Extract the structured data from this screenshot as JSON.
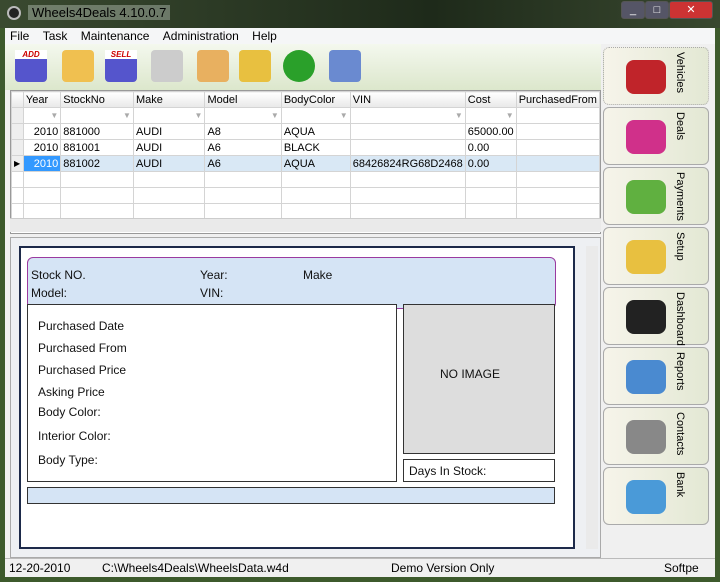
{
  "title": "Wheels4Deals 4.10.0.7",
  "menu": [
    "File",
    "Task",
    "Maintenance",
    "Administration",
    "Help"
  ],
  "toolbar": [
    {
      "name": "add-vehicle",
      "label": "ADD",
      "color": "#5555cc"
    },
    {
      "name": "open-folder",
      "label": "",
      "color": "#f0c050"
    },
    {
      "name": "sell-vehicle",
      "label": "SELL",
      "color": "#5555cc"
    },
    {
      "name": "print",
      "label": "",
      "color": "#cccccc"
    },
    {
      "name": "report",
      "label": "",
      "color": "#e8b060"
    },
    {
      "name": "print-preview",
      "label": "",
      "color": "#e8c040"
    },
    {
      "name": "refresh",
      "label": "",
      "color": "#2aa02a"
    },
    {
      "name": "device",
      "label": "",
      "color": "#6a8ad0"
    }
  ],
  "grid": {
    "columns": [
      "Year",
      "StockNo",
      "Make",
      "Model",
      "BodyColor",
      "VIN",
      "Cost",
      "PurchasedFrom"
    ],
    "rows": [
      [
        "2010",
        "881000",
        "AUDI",
        "A8",
        "AQUA",
        "",
        "65000.00",
        ""
      ],
      [
        "2010",
        "881001",
        "AUDI",
        "A6",
        "BLACK",
        "",
        "0.00",
        ""
      ],
      [
        "2010",
        "881002",
        "AUDI",
        "A6",
        "AQUA",
        "68426824RG68D2468",
        "0.00",
        ""
      ]
    ]
  },
  "detail": {
    "stock": "Stock NO.",
    "year": "Year:",
    "make": "Make",
    "model": "Model:",
    "vin": "VIN:",
    "fields": [
      "Purchased Date",
      "Purchased From",
      "Purchased Price",
      "Asking Price",
      "Body Color:",
      "Interior Color:",
      "Body Type:"
    ],
    "no_image": "NO IMAGE",
    "days": "Days In Stock:"
  },
  "side_tabs": [
    {
      "label": "Vehicles",
      "color": "#c0242a"
    },
    {
      "label": "Deals",
      "color": "#d0308a"
    },
    {
      "label": "Payments",
      "color": "#60b040"
    },
    {
      "label": "Setup",
      "color": "#e8c040"
    },
    {
      "label": "Dashboard",
      "color": "#222222"
    },
    {
      "label": "Reports",
      "color": "#4a8ad0"
    },
    {
      "label": "Contacts",
      "color": "#888888"
    },
    {
      "label": "Bank",
      "color": "#4a9ad8"
    }
  ],
  "status": {
    "date": "12-20-2010",
    "path": "C:\\Wheels4Deals\\WheelsData.w4d",
    "mode": "Demo Version Only",
    "brand": "Softpe"
  }
}
